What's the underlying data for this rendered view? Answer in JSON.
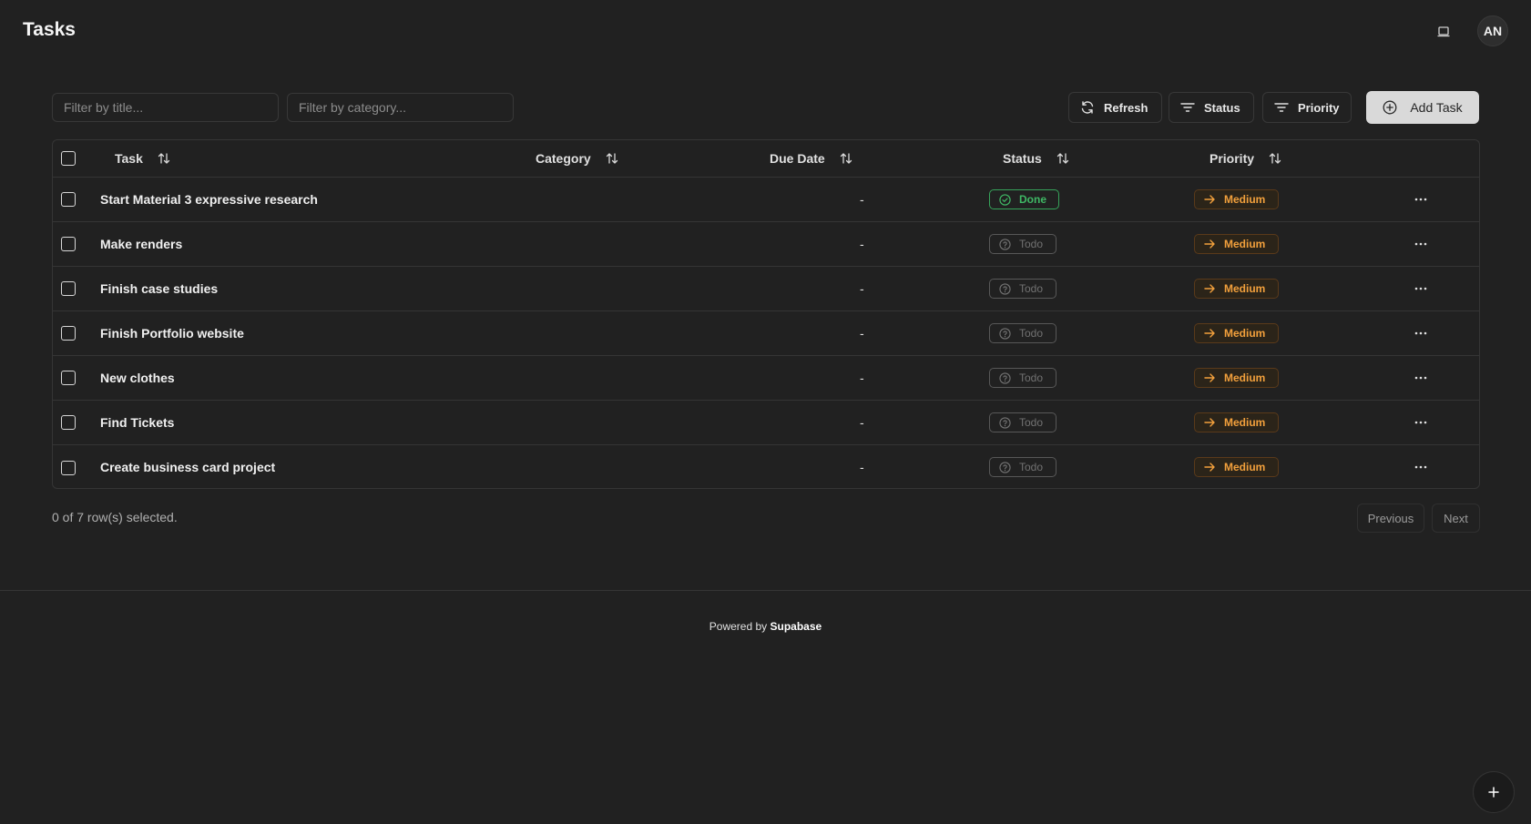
{
  "header": {
    "title": "Tasks",
    "avatar_initials": "AN",
    "theme_icon": "monitor-icon"
  },
  "filters": {
    "title_placeholder": "Filter by title...",
    "category_placeholder": "Filter by category..."
  },
  "toolbar": {
    "refresh_label": "Refresh",
    "status_label": "Status",
    "priority_label": "Priority",
    "add_label": "Add Task"
  },
  "table": {
    "columns": {
      "task": "Task",
      "category": "Category",
      "due_date": "Due Date",
      "status": "Status",
      "priority": "Priority"
    },
    "rows": [
      {
        "task": "Start Material 3 expressive research",
        "due": "-",
        "status": "Done",
        "priority": "Medium"
      },
      {
        "task": "Make renders",
        "due": "-",
        "status": "Todo",
        "priority": "Medium"
      },
      {
        "task": "Finish case studies",
        "due": "-",
        "status": "Todo",
        "priority": "Medium"
      },
      {
        "task": "Finish Portfolio website",
        "due": "-",
        "status": "Todo",
        "priority": "Medium"
      },
      {
        "task": "New clothes",
        "due": "-",
        "status": "Todo",
        "priority": "Medium"
      },
      {
        "task": "Find Tickets",
        "due": "-",
        "status": "Todo",
        "priority": "Medium"
      },
      {
        "task": "Create business card project",
        "due": "-",
        "status": "Todo",
        "priority": "Medium"
      }
    ]
  },
  "pagination": {
    "selected_text": "0 of 7 row(s) selected.",
    "previous_label": "Previous",
    "next_label": "Next"
  },
  "footer": {
    "prefix": "Powered by",
    "brand": "Supabase"
  },
  "colors": {
    "background": "#212121",
    "done": "#3fb865",
    "medium": "#f2a03c"
  }
}
